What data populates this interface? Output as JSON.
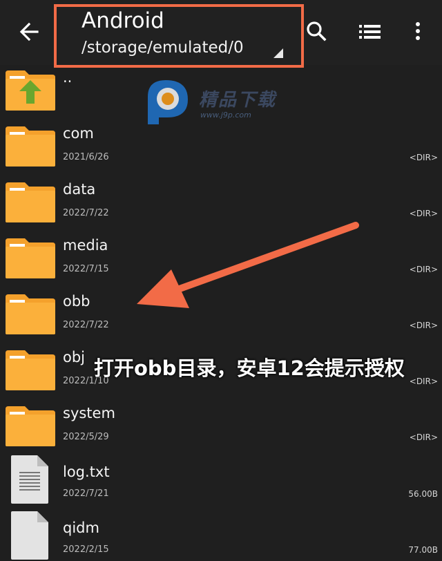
{
  "toolbar": {
    "title": "Android",
    "path": "/storage/emulated/0",
    "icons": {
      "back": "arrow-back-icon",
      "search": "search-icon",
      "list": "list-view-icon",
      "more": "more-vert-icon"
    },
    "highlight_color": "#f26b47"
  },
  "files": [
    {
      "name": "..",
      "date": "",
      "size": "",
      "type": "parent"
    },
    {
      "name": "com",
      "date": "2021/6/26",
      "size": "<DIR>",
      "type": "folder"
    },
    {
      "name": "data",
      "date": "2022/7/22",
      "size": "<DIR>",
      "type": "folder"
    },
    {
      "name": "media",
      "date": "2022/7/15",
      "size": "<DIR>",
      "type": "folder"
    },
    {
      "name": "obb",
      "date": "2022/7/22",
      "size": "<DIR>",
      "type": "folder"
    },
    {
      "name": "obj",
      "date": "2022/1/10",
      "size": "<DIR>",
      "type": "folder"
    },
    {
      "name": "system",
      "date": "2022/5/29",
      "size": "<DIR>",
      "type": "folder"
    },
    {
      "name": "log.txt",
      "date": "2022/7/21",
      "size": "56.00B",
      "type": "text-file"
    },
    {
      "name": "qidm",
      "date": "2022/2/15",
      "size": "77.00B",
      "type": "file"
    }
  ],
  "watermark": {
    "text": "精品下载",
    "url": "www.j9p.com"
  },
  "annotation": {
    "caption": "打开obb目录，安卓12会提示授权",
    "arrow_color": "#f26b47"
  },
  "colors": {
    "folder": "#fbb03b",
    "folder_tab": "#f4a12c",
    "background": "#1f1f1f",
    "parent_arrow": "#6aa62e"
  }
}
